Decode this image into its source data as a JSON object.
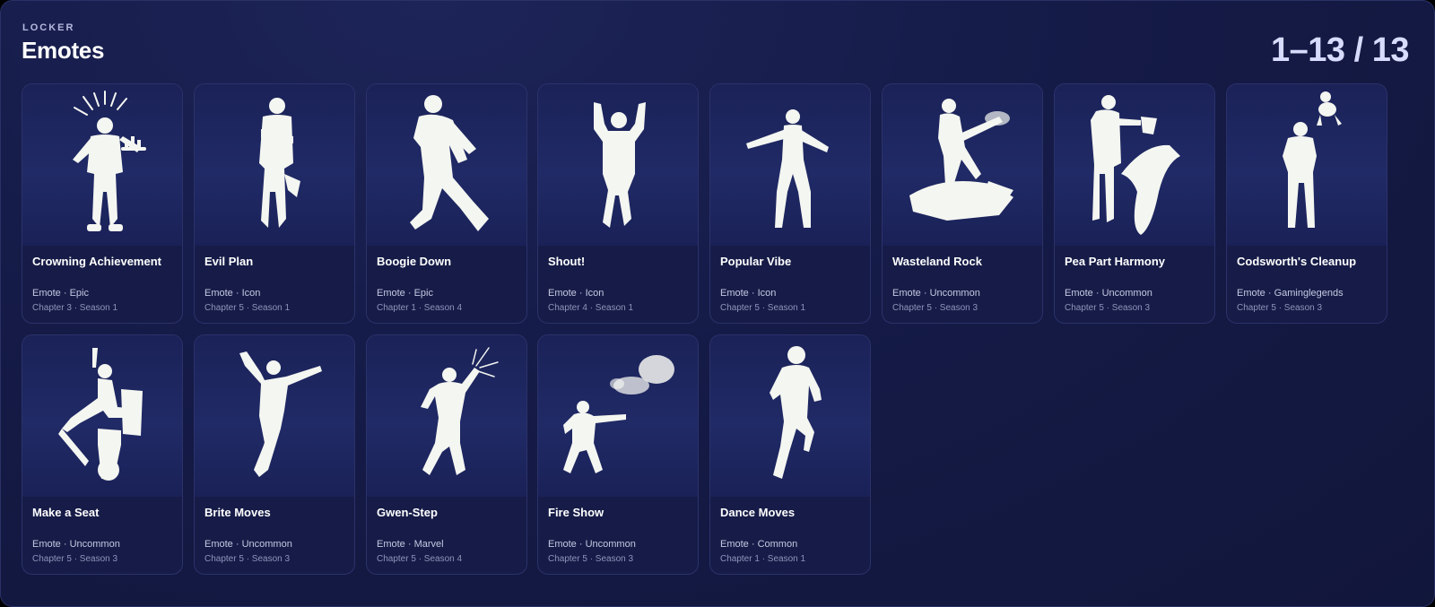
{
  "header": {
    "eyebrow": "LOCKER",
    "title": "Emotes",
    "counter": "1–13 / 13"
  },
  "items": [
    {
      "name": "Crowning Achievement",
      "meta": "Emote · Epic",
      "season": "Chapter 3 · Season 1",
      "icon": "crowning-achievement-icon"
    },
    {
      "name": "Evil Plan",
      "meta": "Emote · Icon",
      "season": "Chapter 5 · Season 1",
      "icon": "evil-plan-icon"
    },
    {
      "name": "Boogie Down",
      "meta": "Emote · Epic",
      "season": "Chapter 1 · Season 4",
      "icon": "boogie-down-icon"
    },
    {
      "name": "Shout!",
      "meta": "Emote · Icon",
      "season": "Chapter 4 · Season 1",
      "icon": "shout-icon"
    },
    {
      "name": "Popular Vibe",
      "meta": "Emote · Icon",
      "season": "Chapter 5 · Season 1",
      "icon": "popular-vibe-icon"
    },
    {
      "name": "Wasteland Rock",
      "meta": "Emote · Uncommon",
      "season": "Chapter 5 · Season 3",
      "icon": "wasteland-rock-icon"
    },
    {
      "name": "Pea Part Harmony",
      "meta": "Emote · Uncommon",
      "season": "Chapter 5 · Season 3",
      "icon": "pea-part-harmony-icon"
    },
    {
      "name": "Codsworth's Cleanup",
      "meta": "Emote · Gaminglegends",
      "season": "Chapter 5 · Season 3",
      "icon": "codsworths-cleanup-icon"
    },
    {
      "name": "Make a Seat",
      "meta": "Emote · Uncommon",
      "season": "Chapter 5 · Season 3",
      "icon": "make-a-seat-icon"
    },
    {
      "name": "Brite Moves",
      "meta": "Emote · Uncommon",
      "season": "Chapter 5 · Season 3",
      "icon": "brite-moves-icon"
    },
    {
      "name": "Gwen-Step",
      "meta": "Emote · Marvel",
      "season": "Chapter 5 · Season 4",
      "icon": "gwen-step-icon"
    },
    {
      "name": "Fire Show",
      "meta": "Emote · Uncommon",
      "season": "Chapter 5 · Season 3",
      "icon": "fire-show-icon"
    },
    {
      "name": "Dance Moves",
      "meta": "Emote · Common",
      "season": "Chapter 1 · Season 1",
      "icon": "dance-moves-icon"
    }
  ],
  "colors": {
    "background": "#151b47",
    "card": "#161c47",
    "silhouette": "#f4f6f1",
    "counter": "#d7dcff"
  }
}
